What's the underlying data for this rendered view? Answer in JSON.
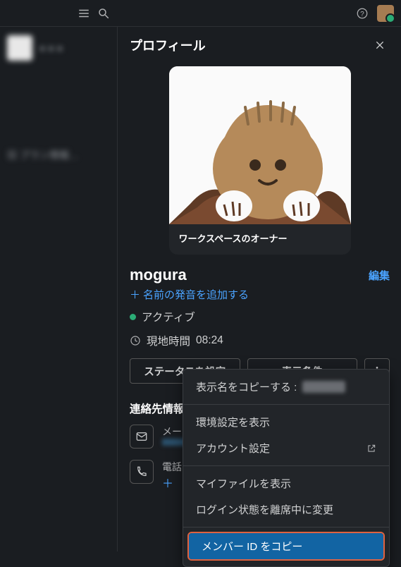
{
  "header": {
    "title": "プロフィール"
  },
  "avatar_card": {
    "role_label": "ワークスペースのオーナー"
  },
  "name_row": {
    "display_name": "mogura",
    "edit": "編集"
  },
  "pronunciation": {
    "prefix": "＋",
    "label": "名前の発音を追加する"
  },
  "status": {
    "active_label": "アクティブ",
    "local_time_label": "現地時間 ",
    "local_time_value": "08:24"
  },
  "buttons": {
    "set_status": "ステータスを設定",
    "display_conditions": "表示条件"
  },
  "contact_section": {
    "heading": "連絡先情報",
    "email_label": "メー",
    "phone_label": "電話",
    "add_prefix": "＋"
  },
  "menu": {
    "copy_display_name": "表示名をコピーする : ",
    "show_prefs": "環境設定を表示",
    "account_settings": "アカウント設定",
    "my_files": "マイファイルを表示",
    "set_away": "ログイン状態を離席中に変更",
    "copy_member_id": "メンバー ID をコピー"
  }
}
